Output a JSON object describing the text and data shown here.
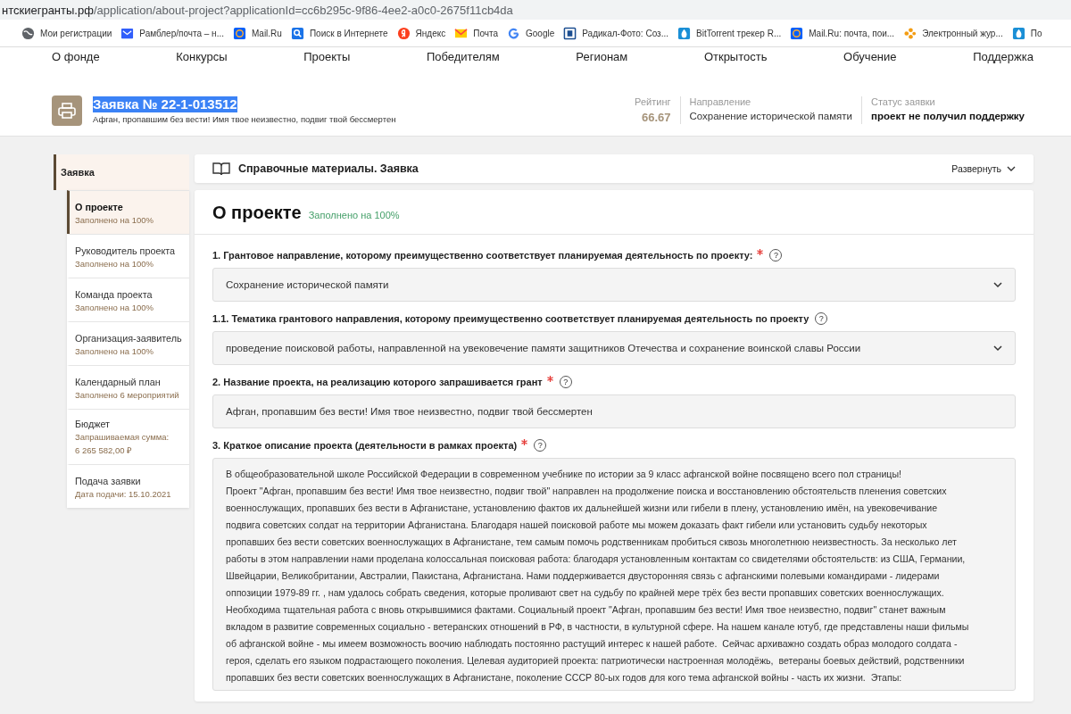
{
  "browser": {
    "address": {
      "host": "нтскиегранты.рф",
      "path": "/application/about-project?applicationId=cc6b295c-9f86-4ee2-a0c0-2675f11cb4da"
    },
    "bookmarks": [
      {
        "label": "Мои регистрации",
        "kind": "globe",
        "color": "#5f6368"
      },
      {
        "label": "Рамблер/почта – н...",
        "kind": "envelope",
        "color": "#315efb"
      },
      {
        "label": "Mail.Ru",
        "kind": "at",
        "color": "#005ff9"
      },
      {
        "label": "Поиск в Интернете",
        "kind": "search",
        "color": "#1a73e8"
      },
      {
        "label": "Яндекс",
        "kind": "letter",
        "color": "#fc3f1d"
      },
      {
        "label": "Почта",
        "kind": "mail",
        "color": "#ffcc00"
      },
      {
        "label": "Google",
        "kind": "g",
        "color": "#4285f4"
      },
      {
        "label": "Радикал-Фото: Соз...",
        "kind": "square",
        "color": "#1d4f91"
      },
      {
        "label": "BitTorrent трекер R...",
        "kind": "drop",
        "color": "#1a8fd6"
      },
      {
        "label": "Mail.Ru: почта, пои...",
        "kind": "at",
        "color": "#005ff9"
      },
      {
        "label": "Электронный жур...",
        "kind": "dots",
        "color": "#f39c12"
      },
      {
        "label": "По",
        "kind": "drop",
        "color": "#1a8fd6"
      }
    ]
  },
  "nav": [
    "О фонде",
    "Конкурсы",
    "Проекты",
    "Победителям",
    "Регионам",
    "Открытость",
    "Обучение",
    "Поддержка"
  ],
  "header": {
    "title": "Заявка № 22-1-013512",
    "title_selected": true,
    "subtitle": "Афган, пропавшим без вести! Имя твое неизвестно, подвиг твой бессмертен",
    "stats": [
      {
        "label": "Рейтинг",
        "value": "66.67",
        "kind": "rating"
      },
      {
        "label": "Направление",
        "value": "Сохранение исторической памяти",
        "kind": "plain"
      },
      {
        "label": "Статус заявки",
        "value": "проект не получил поддержку",
        "kind": "bold"
      }
    ]
  },
  "sidebar": {
    "group": {
      "label": "Заявка",
      "selected": true
    },
    "items": [
      {
        "label": "О проекте",
        "note": "Заполнено на 100%",
        "selected": true
      },
      {
        "label": "Руководитель проекта",
        "note": "Заполнено на 100%",
        "selected": false
      },
      {
        "label": "Команда проекта",
        "note": "Заполнено на 100%",
        "selected": false
      },
      {
        "label": "Организация-заявитель",
        "note": "Заполнено на 100%",
        "selected": false
      },
      {
        "label": "Календарный план",
        "note": "Заполнено 6 мероприятий",
        "selected": false
      },
      {
        "label": "Бюджет",
        "note": "Запрашиваемая сумма:",
        "note2": "6 265 582,00 ₽",
        "selected": false
      },
      {
        "label": "Подача заявки",
        "note": "Дата подачи: 15.10.2021",
        "selected": false
      }
    ]
  },
  "reference": {
    "title": "Справочные материалы. Заявка",
    "toggle": "Развернуть",
    "expanded": false
  },
  "section": {
    "title": "О проекте",
    "status": "Заполнено на 100%",
    "questions": [
      {
        "label": "1. Грантовое направление, которому преимущественно соответствует планируемая деятельность по проекту:",
        "required": true,
        "help": "?",
        "kind": "select",
        "value": "Сохранение исторической памяти"
      },
      {
        "label": "1.1. Тематика грантового направления, которому преимущественно соответствует планируемая деятельность по проекту",
        "required": false,
        "help": "?",
        "kind": "select",
        "value": "проведение поисковой работы, направленной на увековечение памяти защитников Отечества и сохранение воинской славы России"
      },
      {
        "label": "2. Название проекта, на реализацию которого запрашивается грант",
        "required": true,
        "help": "?",
        "kind": "text",
        "value": "Афган, пропавшим без вести! Имя твое неизвестно, подвиг твой бессмертен"
      },
      {
        "label": "3. Краткое описание проекта (деятельности в рамках проекта)",
        "required": true,
        "help": "?",
        "kind": "textarea",
        "lines": [
          "В общеобразовательной школе Российской Федерации в современном учебнике по истории за 9 класс афганской войне посвящено всего пол страницы!",
          "Проект \"Афган, пропавшим без вести! Имя твое неизвестно, подвиг твой\" направлен на продолжение поиска и восстановлению обстоятельств пленения советских",
          "военнослужащих, пропавших без вести в Афганистане, установлению фактов их дальнейшей жизни или гибели в плену, установлению имён, на увековечивание",
          "подвига советских солдат на территории Афганистана. Благодаря нашей поисковой работе мы можем доказать факт гибели или установить судьбу некоторых",
          "пропавших без вести советских военнослужащих в Афганистане, тем самым помочь родственникам пробиться сквозь многолетнюю неизвестность. За несколько лет",
          "работы в этом направлении нами проделана колоссальная поисковая работа: благодаря установленным контактам со свидетелями обстоятельств: из США, Германии,",
          "Швейцарии, Великобритании, Австралии, Пакистана, Афганистана. Нами поддерживается двусторонняя связь с афганскими полевыми командирами - лидерами",
          "оппозиции 1979-89 гг. , нам удалось собрать сведения, которые проливают свет на судьбу по крайней мере трёх без вести пропавших советских военнослужащих.",
          "Необходима тщательная работа с вновь открывшимися фактами. Социальный проект \"Афган, пропавшим без вести! Имя твое неизвестно, подвиг\" станет важным",
          "вкладом в развитие современных социально - ветеранских отношений в РФ, в частности, в культурной сфере. На нашем канале ютуб, где представлены наши фильмы",
          "об афганской войне - мы имеем возможность воочию наблюдать постоянно растущий интерес к нашей работе.  Сейчас архиважно создать образ молодого солдата -",
          "героя, сделать его языком подрастающего поколения. Целевая аудиторией проекта: патриотически настроенная молодёжь,  ветераны боевых действий, родственники",
          "пропавших без вести советских военнослужащих в Афганистане, поколение СССР 80-ых годов для кого тема афганской войны - часть их жизни.  Этапы:"
        ]
      }
    ]
  }
}
